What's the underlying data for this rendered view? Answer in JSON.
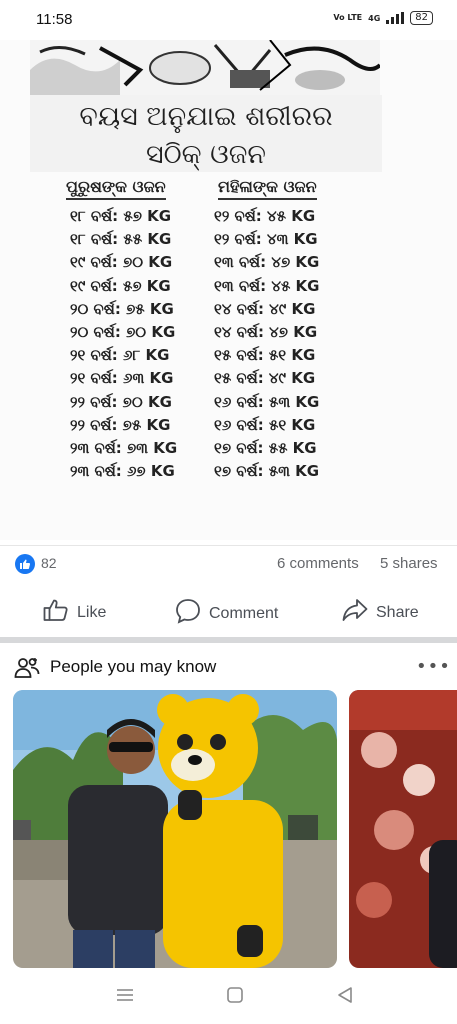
{
  "status_bar": {
    "time": "11:58",
    "network_label": "4G",
    "volte_label": "Vo LTE",
    "battery": "82"
  },
  "post": {
    "title_line1": "ବୟସ ଅନୁଯାଇ ଶରୀରର",
    "title_line2": "ସଠିକ୍ ଓଜନ",
    "men_header": "ପୁରୁଷଙ୍କ ଓଜନ",
    "women_header": "ମହିଳାଙ୍କ ଓଜନ",
    "men_rows": [
      "୧୮ ବର୍ଷ: ୫୭ KG",
      "୧୮ ବର୍ଷ: ୫୫ KG",
      "୧୯ ବର୍ଷ: ୭୦ KG",
      "୧୯ ବର୍ଷ: ୫୭ KG",
      "୨୦ ବର୍ଷ: ୭୫ KG",
      "୨୦ ବର୍ଷ: ୭୦ KG",
      "୨୧ ବର୍ଷ: ୬୮ KG",
      "୨୧ ବର୍ଷ: ୬୩ KG",
      "୨୨ ବର୍ଷ: ୭୦ KG",
      "୨୨ ବର୍ଷ: ୭୫ KG",
      "୨୩ ବର୍ଷ: ୭୩ KG",
      "୨୩ ବର୍ଷ: ୬୭ KG"
    ],
    "women_rows": [
      "୧୨ ବର୍ଷ: ୪୫ KG",
      "୧୨ ବର୍ଷ: ୪୩ KG",
      "୧୩ ବର୍ଷ: ୪୭ KG",
      "୧୩ ବର୍ଷ: ୪୫ KG",
      "୧୪ ବର୍ଷ: ୪୯ KG",
      "୧୪ ବର୍ଷ: ୪୭ KG",
      "୧୫ ବର୍ଷ: ୫୧ KG",
      "୧୫ ବର୍ଷ: ୪୯ KG",
      "୧୬ ବର୍ଷ: ୫୩ KG",
      "୧୬ ବର୍ଷ: ୫୧ KG",
      "୧୭ ବର୍ଷ: ୫୫ KG",
      "୧୭ ବର୍ଷ: ୫୩ KG"
    ]
  },
  "engagement": {
    "like_count": "82",
    "comments": "6 comments",
    "shares": "5 shares"
  },
  "actions": {
    "like": "Like",
    "comment": "Comment",
    "share": "Share"
  },
  "pymk": {
    "title": "People you may know"
  },
  "colors": {
    "facebook_blue": "#1877f2",
    "mascot_yellow": "#f5c400",
    "separator": "#d7d8da"
  },
  "icons": {
    "like": "thumbs-up-icon",
    "comment": "comment-bubble-icon",
    "share": "share-arrow-icon",
    "people": "people-icon",
    "more": "more-dots-icon"
  }
}
